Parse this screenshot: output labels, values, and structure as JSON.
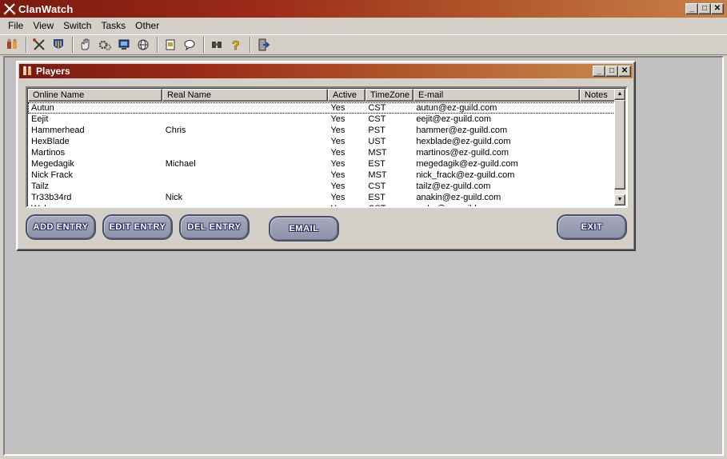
{
  "app": {
    "title": "ClanWatch"
  },
  "window_controls": {
    "minimize": "_",
    "maximize": "□",
    "close": "✕"
  },
  "menu": [
    "File",
    "View",
    "Switch",
    "Tasks",
    "Other"
  ],
  "toolbar_icons": [
    "players-icon",
    "tools-icon",
    "guild-icon",
    "hand-icon",
    "gears-icon",
    "server-icon",
    "globe-icon",
    "notes-icon",
    "chat-icon",
    "binoculars-icon",
    "help-icon",
    "exit-door-icon"
  ],
  "players_window": {
    "title": "Players",
    "columns": [
      "Online Name",
      "Real Name",
      "Active",
      "TimeZone",
      "E-mail",
      "Notes"
    ],
    "rows": [
      [
        "Autun",
        "",
        "Yes",
        "CST",
        "autun@ez-guild.com",
        ""
      ],
      [
        "Eejit",
        "",
        "Yes",
        "CST",
        "eejit@ez-guild.com",
        ""
      ],
      [
        "Hammerhead",
        "Chris",
        "Yes",
        "PST",
        "hammer@ez-guild.com",
        ""
      ],
      [
        "HexBlade",
        "",
        "Yes",
        "UST",
        "hexblade@ez-guild.com",
        ""
      ],
      [
        "Martinos",
        "",
        "Yes",
        "MST",
        "martinos@ez-guild.com",
        ""
      ],
      [
        "Megedagik",
        "Michael",
        "Yes",
        "EST",
        "megedagik@ez-guild.com",
        ""
      ],
      [
        "Nick Frack",
        "",
        "Yes",
        "MST",
        "nick_frack@ez-guild.com",
        ""
      ],
      [
        "Tailz",
        "",
        "Yes",
        "CST",
        "tailz@ez-guild.com",
        ""
      ],
      [
        "Tr33b34rd",
        "Nick",
        "Yes",
        "EST",
        "anakin@ez-guild.com",
        ""
      ],
      [
        "Wobs",
        "",
        "Yes",
        "CST",
        "wobs@ez-guild.com",
        ""
      ]
    ],
    "buttons": {
      "add": "ADD ENTRY",
      "edit": "EDIT ENTRY",
      "del": "DEL ENTRY",
      "email": "EMAIL",
      "exit": "EXIT"
    }
  }
}
